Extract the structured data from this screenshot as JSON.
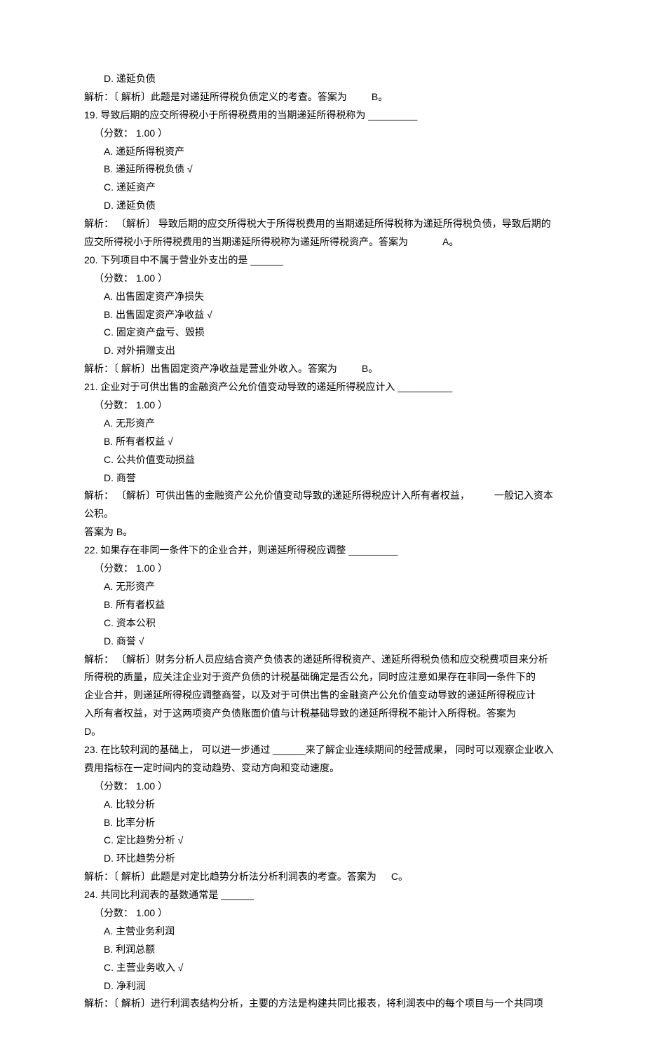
{
  "q18": {
    "optD": "D.  递延负债",
    "explain_pre": "解析：〔 解析〕此题是对递延所得税负债定义的考查。答案为",
    "explain_ans": "B。"
  },
  "q19": {
    "stem": "19.  导致后期的应交所得税小于所得税费用的当期递延所得税称为  _________",
    "score": "（分数： 1.00 ）",
    "optA": "A.  递延所得税资产",
    "optB": "B.  递延所得税负债  √",
    "optC": "C.  递延资产",
    "optD": "D.  递延负债",
    "explain_l1": "解析： 〔解析〕 导致后期的应交所得税大于所得税费用的当期递延所得税称为递延所得税负债，导致后期的",
    "explain_l2_pre": "应交所得税小于所得税费用的当期递延所得税称为递延所得税资产。答案为",
    "explain_l2_ans": "A。"
  },
  "q20": {
    "stem": "20.  下列项目中不属于营业外支出的是  ______",
    "score": "（分数： 1.00 ）",
    "optA": "A.  出售固定资产净损失",
    "optB": "B.  出售固定资产净收益  √",
    "optC": "C.  固定资产盘亏、毁损",
    "optD": "D.  对外捐赠支出",
    "explain_pre": "解析：〔 解析〕出售固定资产净收益是营业外收入。答案为",
    "explain_ans": "B。"
  },
  "q21": {
    "stem": "21.  企业对于可供出售的金融资产公允价值变动导致的递延所得税应计入  __________",
    "score": "（分数： 1.00 ）",
    "optA": "A.  无形资产",
    "optB": "B.  所有者权益  √",
    "optC": "C.  公共价值变动损益",
    "optD": "D.  商誉",
    "explain_l1_pre": "解析： 〔解析〕可供出售的金融资产公允价值变动导致的递延所得税应计入所有者权益，",
    "explain_l1_post": "一般记入资本公积。",
    "explain_l2": "答案为 B。"
  },
  "q22": {
    "stem": "22.  如果存在非同一条件下的企业合并，则递延所得税应调整  _________",
    "score": "（分数： 1.00 ）",
    "optA": "A.  无形资产",
    "optB": "B.  所有者权益",
    "optC": "C.  资本公积",
    "optD": "D.  商誉  √",
    "explain_l1": "解析： 〔解析〕财务分析人员应结合资产负债表的递延所得税资产、递延所得税负债和应交税费项目来分析",
    "explain_l2": "所得税的质量，应关注企业对于资产负债的计税基础确定是否公允，同时应注意如果存在非同一条件下的",
    "explain_l3": "企业合并，则递延所得税应调整商誉，以及对于可供出售的金融资产公允价值变动导致的递延所得税应计",
    "explain_l4_pre": "入所有者权益，对于这两项资产负债账面价值与计税基础导致的递延所得税不能计入所得税。答案为",
    "explain_l4_ans": "D。"
  },
  "q23": {
    "stem_l1_pre": "23.  在比较利润的基础上， 可以进一步通过  ______来了解企业连续期间的经营成果， 同时可以观察企业收入",
    "stem_l2": "费用指标在一定时间内的变动趋势、变动方向和变动速度。",
    "score": "（分数： 1.00 ）",
    "optA": "A.  比较分析",
    "optB": "B.  比率分析",
    "optC": "C.  定比趋势分析  √",
    "optD": "D.  环比趋势分析",
    "explain_pre": "解析：〔 解析〕此题是对定比趋势分析法分析利润表的考查。答案为",
    "explain_ans": "C。"
  },
  "q24": {
    "stem": "24.  共同比利润表的基数通常是  ______",
    "score": "（分数： 1.00 ）",
    "optA": "A.  主营业务利润",
    "optB": "B.  利润总额",
    "optC": "C.  主营业务收入   √",
    "optD": "D.  净利润",
    "explain": "解析：〔 解析〕进行利润表结构分析，主要的方法是构建共同比报表，将利润表中的每个项目与一个共同项"
  }
}
